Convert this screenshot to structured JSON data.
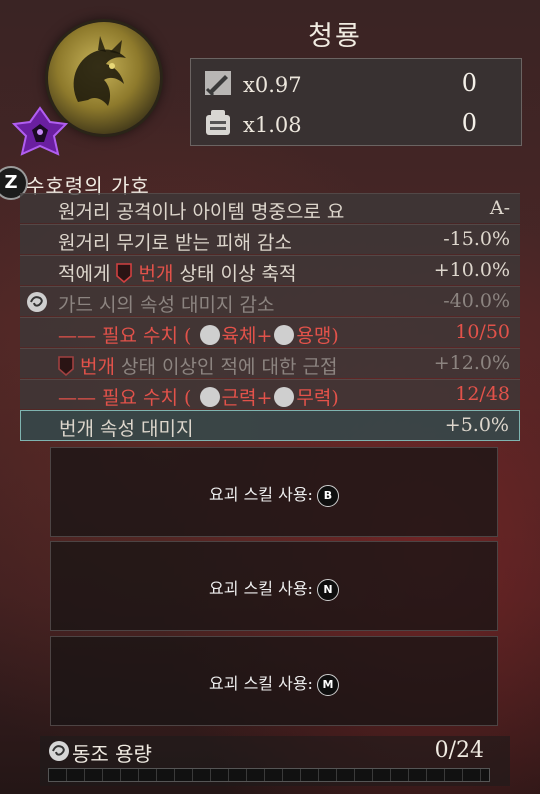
{
  "header": {
    "title": "청룡"
  },
  "stats": [
    {
      "icon": "sword-icon",
      "multiplier": "x0.97",
      "value": "0"
    },
    {
      "icon": "armor-icon",
      "multiplier": "x1.08",
      "value": "0"
    }
  ],
  "guardian": {
    "key": "Z",
    "title": "수호령의 가호",
    "effects": [
      {
        "label": "원거리 공격이나 아이템 명중으로 요",
        "value": "A-"
      },
      {
        "label": "원거리 무기로 받는 피해 감소",
        "value": "-15.0%"
      },
      {
        "label_pre": "적에게 ",
        "label_red": "번개",
        "label_post": " 상태 이상 축적",
        "value": "+10.0%"
      },
      {
        "label": "가드 시의 속성 대미지 감소",
        "value": "-40.0%"
      },
      {
        "label_pre": "—— 필요 수치 ( ",
        "stat1": "육체",
        "plus": "+",
        "stat2": "용맹",
        "label_post": ")",
        "value": "10/50"
      },
      {
        "label_red": "번개",
        "label_post": " 상태 이상인 적에 대한 근접",
        "value": "+12.0%"
      },
      {
        "label_pre": "—— 필요 수치 ( ",
        "stat1": "근력",
        "plus": "+",
        "stat2": "무력",
        "label_post": ")",
        "value": "12/48"
      },
      {
        "label": "번개 속성 대미지",
        "value": "+5.0%"
      }
    ]
  },
  "skills": [
    {
      "label": "요괴 스킬 사용:",
      "key": "B"
    },
    {
      "label": "요괴 스킬 사용:",
      "key": "N"
    },
    {
      "label": "요괴 스킬 사용:",
      "key": "M"
    }
  ],
  "sync": {
    "label": "동조 용량",
    "value": "0/24",
    "fill": 0
  },
  "colors": {
    "accent_red": "#e2524a",
    "highlight_border": "#7fb4b0",
    "rank_purple": "#9b3fd8"
  }
}
